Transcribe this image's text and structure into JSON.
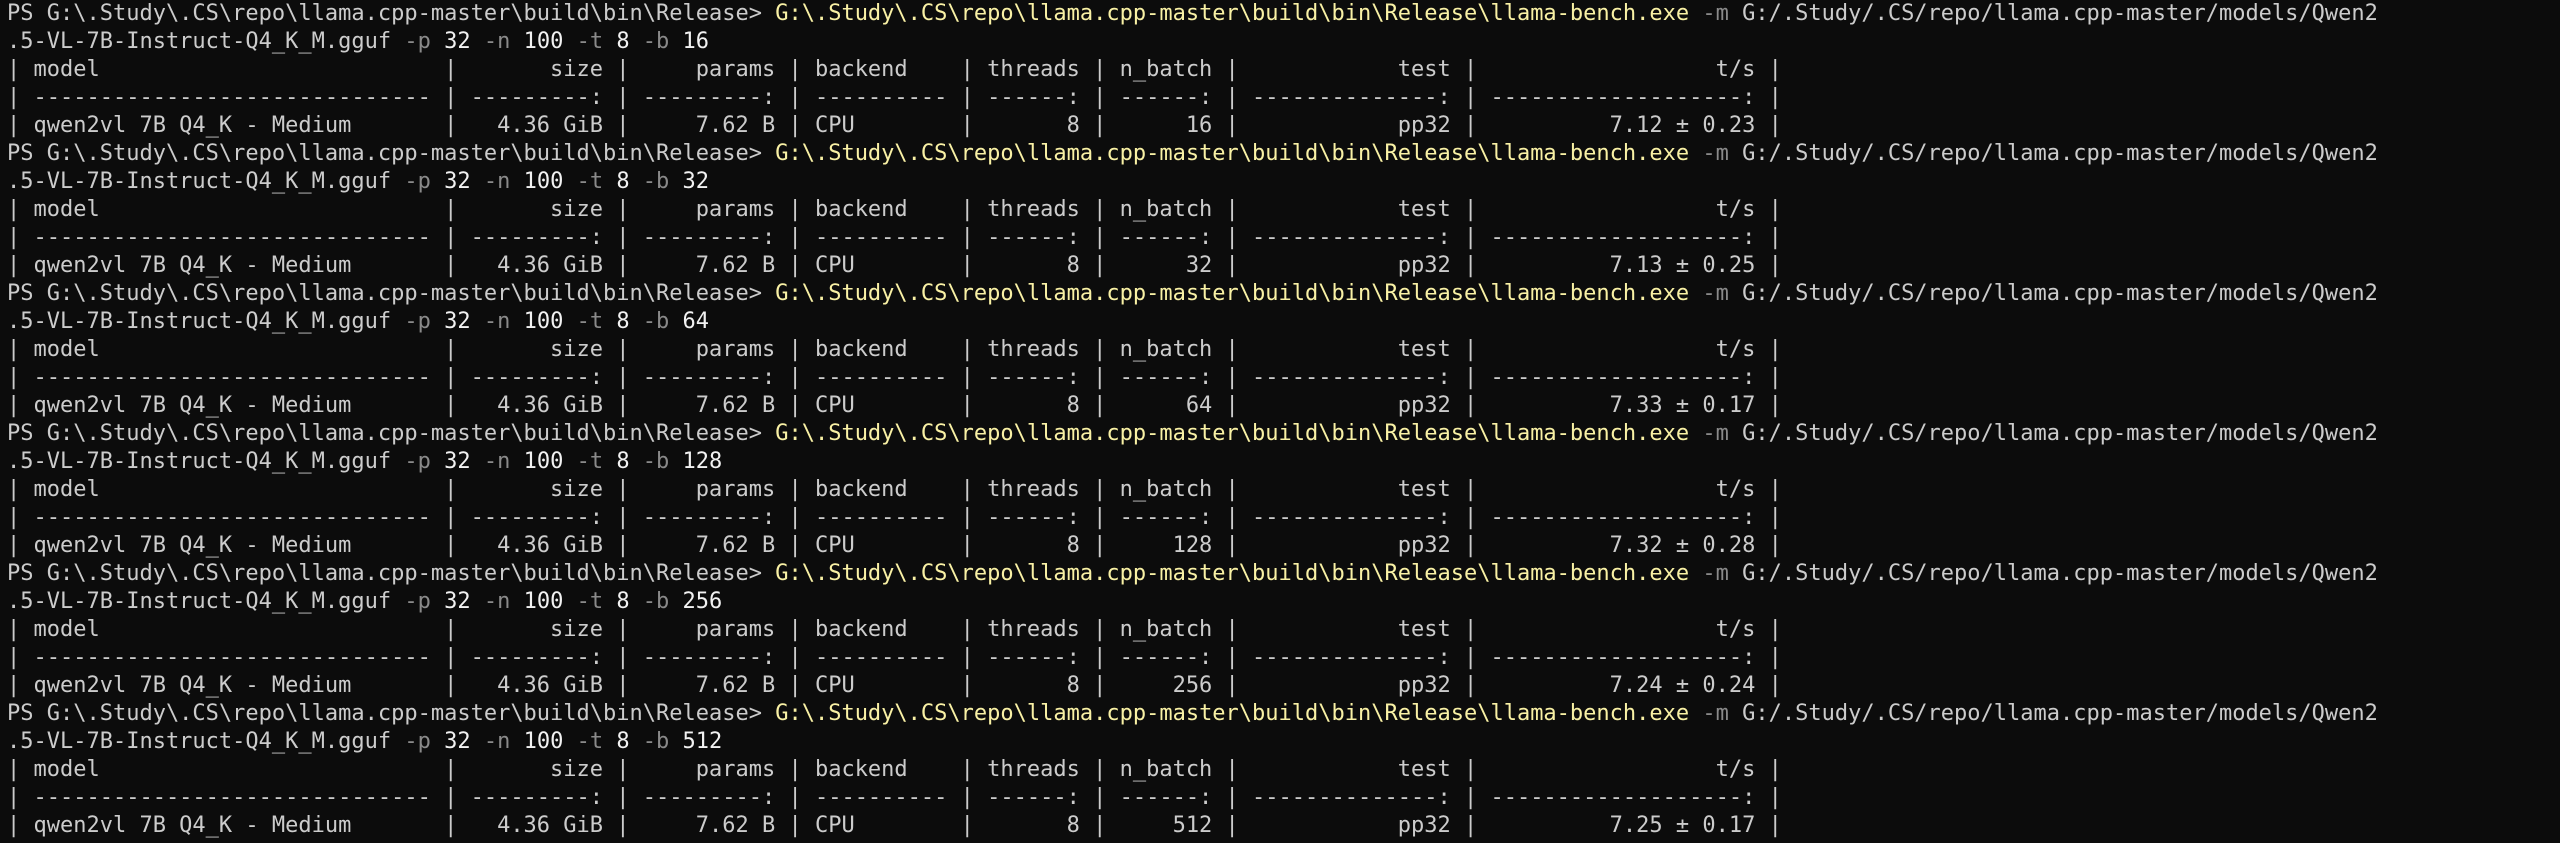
{
  "terminal": {
    "prompt": "PS G:\\.Study\\.CS\\repo\\llama.cpp-master\\build\\bin\\Release> ",
    "exe": "G:\\.Study\\.CS\\repo\\llama.cpp-master\\build\\bin\\Release\\llama-bench.exe",
    "model_flag": " -m ",
    "model_path_part1": "G:/.Study/.CS/repo/llama.cpp-master/models/Qwen2",
    "model_path_part2": ".5-VL-7B-Instruct-Q4_K_M.gguf",
    "p_flag": " -p ",
    "p_val": "32",
    "n_flag": " -n ",
    "n_val": "100",
    "t_flag": " -t ",
    "t_val": "8",
    "b_flag": " -b ",
    "table_header": "| model                          |       size |     params | backend    | threads | n_batch |            test |                  t/s |",
    "table_separator": "| ------------------------------ | ---------: | ---------: | ---------- | ------: | ------: | --------------: | -------------------: |",
    "runs": [
      {
        "batch": "16",
        "row": "| qwen2vl 7B Q4_K - Medium       |   4.36 GiB |     7.62 B | CPU        |       8 |      16 |            pp32 |          7.12 ± 0.23 |"
      },
      {
        "batch": "32",
        "row": "| qwen2vl 7B Q4_K - Medium       |   4.36 GiB |     7.62 B | CPU        |       8 |      32 |            pp32 |          7.13 ± 0.25 |"
      },
      {
        "batch": "64",
        "row": "| qwen2vl 7B Q4_K - Medium       |   4.36 GiB |     7.62 B | CPU        |       8 |      64 |            pp32 |          7.33 ± 0.17 |"
      },
      {
        "batch": "128",
        "row": "| qwen2vl 7B Q4_K - Medium       |   4.36 GiB |     7.62 B | CPU        |       8 |     128 |            pp32 |          7.32 ± 0.28 |"
      },
      {
        "batch": "256",
        "row": "| qwen2vl 7B Q4_K - Medium       |   4.36 GiB |     7.62 B | CPU        |       8 |     256 |            pp32 |          7.24 ± 0.24 |"
      },
      {
        "batch": "512",
        "row": "| qwen2vl 7B Q4_K - Medium       |   4.36 GiB |     7.62 B | CPU        |       8 |     512 |            pp32 |          7.25 ± 0.17 |"
      }
    ]
  }
}
